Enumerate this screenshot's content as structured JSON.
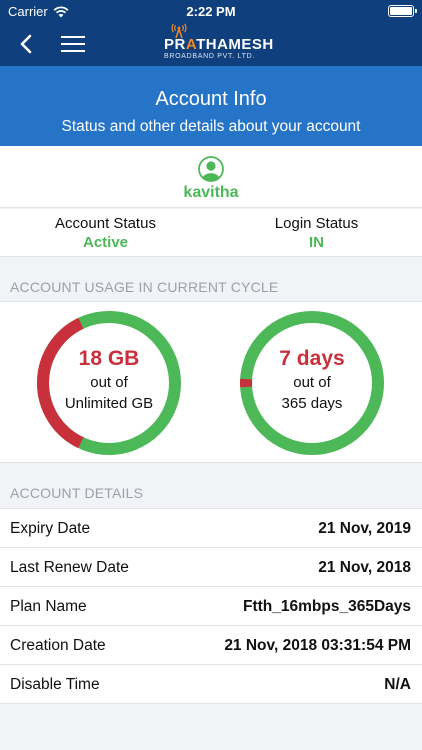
{
  "status_bar": {
    "carrier": "Carrier",
    "time": "2:22 PM"
  },
  "nav": {
    "logo_brand_pre": "PR",
    "logo_brand_accent": "A",
    "logo_brand_post": "THAMESH",
    "logo_subtitle": "BROADBAND PVT. LTD."
  },
  "hero": {
    "title": "Account Info",
    "subtitle": "Status and other details about your account"
  },
  "user": {
    "username": "kavitha"
  },
  "status": {
    "account_label": "Account Status",
    "account_value": "Active",
    "login_label": "Login Status",
    "login_value": "IN"
  },
  "usage": {
    "header": "ACCOUNT USAGE IN CURRENT CYCLE",
    "data": {
      "value": "18 GB",
      "of_label": "out of",
      "limit": "Unlimited GB",
      "used_fraction": 0.36
    },
    "days": {
      "value": "7 days",
      "of_label": "out of",
      "limit": "365 days",
      "used_fraction": 0.019
    }
  },
  "details": {
    "header": "ACCOUNT DETAILS",
    "rows": [
      {
        "label": "Expiry Date",
        "value": "21 Nov, 2019"
      },
      {
        "label": "Last Renew Date",
        "value": "21 Nov, 2018"
      },
      {
        "label": "Plan Name",
        "value": "Ftth_16mbps_365Days"
      },
      {
        "label": "Creation Date",
        "value": "21 Nov, 2018 03:31:54 PM"
      },
      {
        "label": "Disable Time",
        "value": "N/A"
      }
    ]
  },
  "colors": {
    "nav_bg": "#0f3f7c",
    "hero_bg": "#2674c7",
    "accent_green": "#4cb858",
    "accent_red": "#c8313c",
    "logo_orange": "#f08a24"
  },
  "icons": {
    "status": [
      "wifi-icon",
      "battery-icon"
    ],
    "nav": [
      "back-chevron-icon",
      "hamburger-menu-icon",
      "tower-signal-icon"
    ],
    "user": "user-avatar-icon"
  }
}
